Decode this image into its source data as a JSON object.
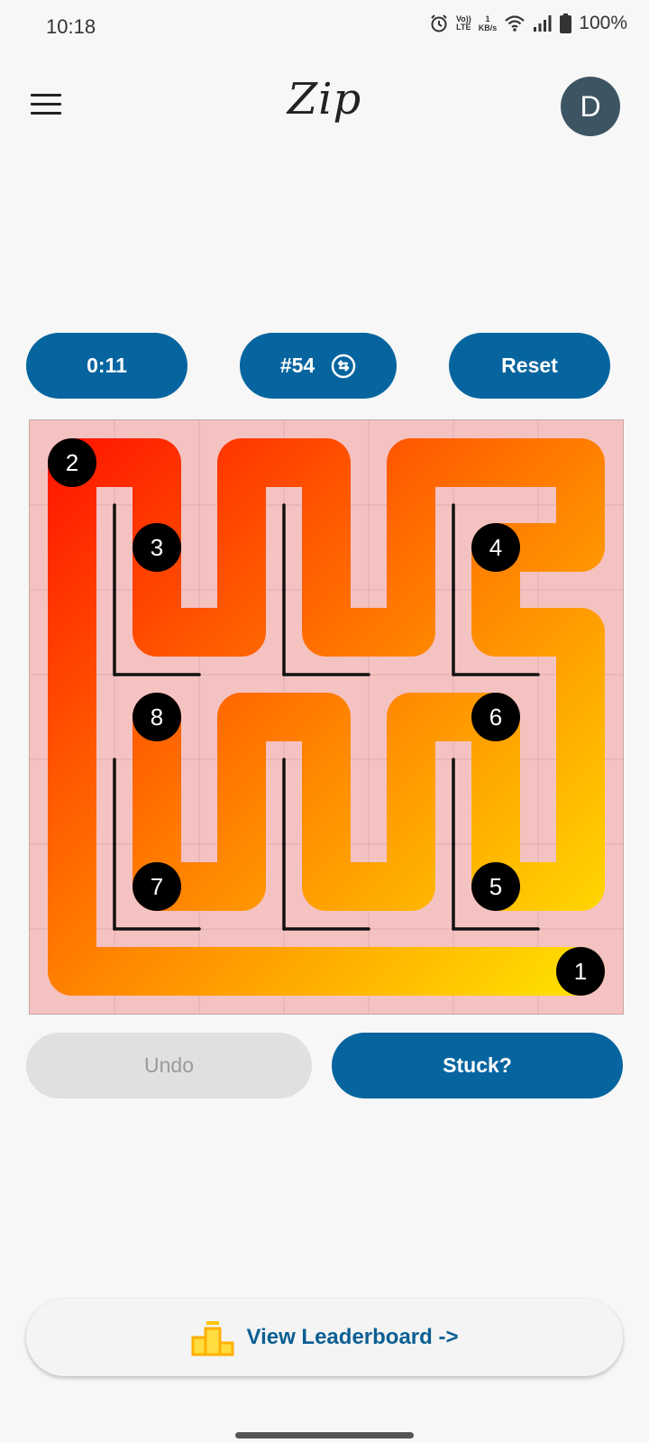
{
  "status_bar": {
    "time": "10:18",
    "network_top": "Vo))",
    "network_bottom": "LTE",
    "speed_value": "1",
    "speed_unit": "KB/s",
    "battery": "100%"
  },
  "header": {
    "logo": "Zip",
    "avatar_letter": "D",
    "menu_icon": "hamburger-menu-icon"
  },
  "controls": {
    "timer": "0:11",
    "puzzle_number": "#54",
    "reset_label": "Reset"
  },
  "puzzle": {
    "grid_size": 7,
    "numbered_cells": [
      {
        "label": "1",
        "row": 6,
        "col": 6
      },
      {
        "label": "2",
        "row": 0,
        "col": 0
      },
      {
        "label": "3",
        "row": 1,
        "col": 1
      },
      {
        "label": "4",
        "row": 1,
        "col": 5
      },
      {
        "label": "5",
        "row": 5,
        "col": 5
      },
      {
        "label": "6",
        "row": 3,
        "col": 5
      },
      {
        "label": "7",
        "row": 5,
        "col": 1
      },
      {
        "label": "8",
        "row": 3,
        "col": 1
      }
    ],
    "path_cells": [
      [
        6,
        6
      ],
      [
        6,
        5
      ],
      [
        6,
        4
      ],
      [
        6,
        3
      ],
      [
        6,
        2
      ],
      [
        6,
        1
      ],
      [
        6,
        0
      ],
      [
        5,
        0
      ],
      [
        4,
        0
      ],
      [
        3,
        0
      ],
      [
        2,
        0
      ],
      [
        1,
        0
      ],
      [
        0,
        0
      ],
      [
        0,
        1
      ],
      [
        1,
        1
      ],
      [
        2,
        1
      ],
      [
        2,
        2
      ],
      [
        1,
        2
      ],
      [
        0,
        2
      ],
      [
        0,
        3
      ],
      [
        1,
        3
      ],
      [
        2,
        3
      ],
      [
        2,
        4
      ],
      [
        1,
        4
      ],
      [
        0,
        4
      ],
      [
        0,
        5
      ],
      [
        0,
        6
      ],
      [
        1,
        6
      ],
      [
        1,
        5
      ],
      [
        2,
        5
      ],
      [
        2,
        6
      ],
      [
        3,
        6
      ],
      [
        4,
        6
      ],
      [
        5,
        6
      ],
      [
        5,
        5
      ],
      [
        4,
        5
      ],
      [
        3,
        5
      ],
      [
        3,
        4
      ],
      [
        4,
        4
      ],
      [
        5,
        4
      ],
      [
        5,
        3
      ],
      [
        4,
        3
      ],
      [
        3,
        3
      ],
      [
        3,
        2
      ],
      [
        4,
        2
      ],
      [
        5,
        2
      ],
      [
        5,
        1
      ],
      [
        4,
        1
      ],
      [
        3,
        1
      ]
    ],
    "path_colors": {
      "start": "#ffe000",
      "mid": "#ff8a00",
      "end": "#ff1a00"
    },
    "board_background": "#f5c2c2",
    "walls": [
      {
        "r1": 1,
        "c1": 0,
        "r2": 1,
        "c2": 1
      },
      {
        "r1": 2,
        "c1": 0,
        "r2": 2,
        "c2": 1
      },
      {
        "r1": 2,
        "c1": 1,
        "r2": 3,
        "c2": 1
      },
      {
        "r1": 1,
        "c1": 2,
        "r2": 1,
        "c2": 3
      },
      {
        "r1": 2,
        "c1": 2,
        "r2": 2,
        "c2": 3
      },
      {
        "r1": 2,
        "c1": 3,
        "r2": 3,
        "c2": 3
      },
      {
        "r1": 1,
        "c1": 4,
        "r2": 1,
        "c2": 5
      },
      {
        "r1": 2,
        "c1": 4,
        "r2": 2,
        "c2": 5
      },
      {
        "r1": 2,
        "c1": 5,
        "r2": 3,
        "c2": 5
      },
      {
        "r1": 4,
        "c1": 0,
        "r2": 4,
        "c2": 1
      },
      {
        "r1": 5,
        "c1": 0,
        "r2": 5,
        "c2": 1
      },
      {
        "r1": 5,
        "c1": 1,
        "r2": 6,
        "c2": 1
      },
      {
        "r1": 4,
        "c1": 2,
        "r2": 4,
        "c2": 3
      },
      {
        "r1": 5,
        "c1": 2,
        "r2": 5,
        "c2": 3
      },
      {
        "r1": 5,
        "c1": 3,
        "r2": 6,
        "c2": 3
      },
      {
        "r1": 4,
        "c1": 4,
        "r2": 4,
        "c2": 5
      },
      {
        "r1": 5,
        "c1": 4,
        "r2": 5,
        "c2": 5
      },
      {
        "r1": 5,
        "c1": 5,
        "r2": 6,
        "c2": 5
      }
    ]
  },
  "actions": {
    "undo_label": "Undo",
    "stuck_label": "Stuck?"
  },
  "leaderboard": {
    "label": "View Leaderboard  ->",
    "icon": "podium-icon",
    "icon_color": "#ffc400"
  }
}
